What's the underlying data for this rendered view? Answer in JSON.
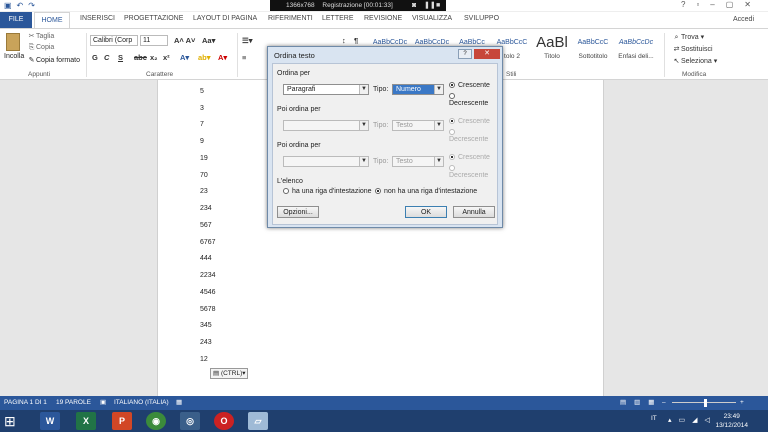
{
  "recording": {
    "size": "1366x768",
    "label": "Registrazione [00:01:33]"
  },
  "tabs": [
    "FILE",
    "HOME",
    "INSERISCI",
    "PROGETTAZIONE",
    "LAYOUT DI PAGINA",
    "RIFERIMENTI",
    "LETTERE",
    "REVISIONE",
    "VISUALIZZA",
    "SVILUPPO"
  ],
  "account": "Accedi",
  "ribbon": {
    "paste": "Incolla",
    "cut": "Taglia",
    "copy": "Copia",
    "format_painter": "Copia formato",
    "clipboard_group": "Appunti",
    "font_name": "Calibri (Corp",
    "font_size": "11",
    "font_group": "Carattere",
    "styles": [
      {
        "preview": "AaBbCcDc",
        "name": ""
      },
      {
        "preview": "AaBbCcDc",
        "name": ""
      },
      {
        "preview": "AaBbCc",
        "name": ""
      },
      {
        "preview": "AaBbCcC",
        "name": "tolo 2"
      },
      {
        "preview": "AaBl",
        "name": "Titolo"
      },
      {
        "preview": "AaBbCcC",
        "name": "Sottotitolo"
      },
      {
        "preview": "AaBbCcDc",
        "name": "Enfasi deli..."
      }
    ],
    "styles_group": "Stili",
    "find": "Trova",
    "replace": "Sostituisci",
    "select": "Seleziona",
    "edit_group": "Modifica"
  },
  "document": {
    "numbers": [
      "5",
      "3",
      "7",
      "9",
      "19",
      "70",
      "23",
      "234",
      "567",
      "6767",
      "444",
      "2234",
      "4546",
      "5678",
      "345",
      "243",
      "12"
    ],
    "paste_tag": "(CTRL)"
  },
  "dialog": {
    "title": "Ordina testo",
    "help": "?",
    "close": "✕",
    "sort_by_label": "Ordina per",
    "sort_by_value": "Paragrafi",
    "type_label": "Tipo:",
    "type_value": "Numero",
    "ascending": "Crescente",
    "descending": "Decrescente",
    "then_by_label": "Poi ordina per",
    "then_type_value": "Testo",
    "list_label": "L'elenco",
    "has_header": "ha una riga d'intestazione",
    "no_header": "non ha una riga d'intestazione",
    "options_button": "Opzioni...",
    "ok_button": "OK",
    "cancel_button": "Annulla"
  },
  "status": {
    "page": "PAGINA 1 DI 1",
    "words": "19 PAROLE",
    "language": "ITALIANO (ITALIA)"
  },
  "taskbar": {
    "lang": "IT",
    "time": "23:49",
    "date": "13/12/2014"
  },
  "colors": {
    "accent": "#2b579a",
    "taskbar": "#1f3f6e"
  }
}
